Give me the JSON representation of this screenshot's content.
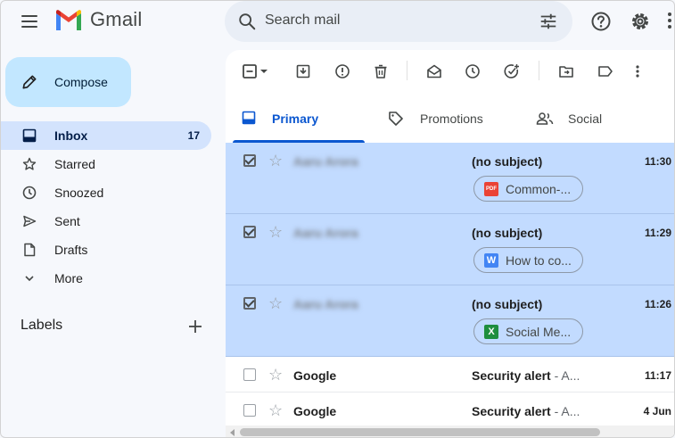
{
  "app": {
    "logo_text": "Gmail"
  },
  "search": {
    "placeholder": "Search mail"
  },
  "compose": {
    "label": "Compose"
  },
  "nav": {
    "items": [
      {
        "label": "Inbox",
        "count": "17",
        "icon": "inbox-icon",
        "active": true
      },
      {
        "label": "Starred",
        "icon": "star-icon"
      },
      {
        "label": "Snoozed",
        "icon": "clock-icon"
      },
      {
        "label": "Sent",
        "icon": "send-icon"
      },
      {
        "label": "Drafts",
        "icon": "draft-icon"
      },
      {
        "label": "More",
        "icon": "chevron-down-icon"
      }
    ],
    "labels_heading": "Labels"
  },
  "tabs": [
    {
      "label": "Primary",
      "icon": "inbox-icon",
      "active": true
    },
    {
      "label": "Promotions",
      "icon": "tag-icon"
    },
    {
      "label": "Social",
      "icon": "people-icon"
    }
  ],
  "emails": [
    {
      "sender": "Aaru Arora",
      "subject": "(no subject)",
      "time": "11:30",
      "selected": true,
      "attachment": {
        "name": "Common-...",
        "type": "PDF",
        "color": "#ea4335"
      }
    },
    {
      "sender": "Aaru Arora",
      "subject": "(no subject)",
      "time": "11:29",
      "selected": true,
      "attachment": {
        "name": "How to co...",
        "type": "W",
        "color": "#4285f4"
      }
    },
    {
      "sender": "Aaru Arora",
      "subject": "(no subject)",
      "time": "11:26",
      "selected": true,
      "attachment": {
        "name": "Social Me...",
        "type": "X",
        "color": "#1e8e3e"
      }
    },
    {
      "sender": "Google",
      "subject": "Security alert",
      "snippet": " - A...",
      "time": "11:17",
      "selected": false
    },
    {
      "sender": "Google",
      "subject": "Security alert",
      "snippet": " - A...",
      "time": "4 Jun",
      "selected": false
    }
  ],
  "colors": {
    "selected_row": "#c2dbff",
    "accent": "#0b57d0",
    "compose_bg": "#c2e7ff",
    "active_nav": "#d3e3fd"
  }
}
